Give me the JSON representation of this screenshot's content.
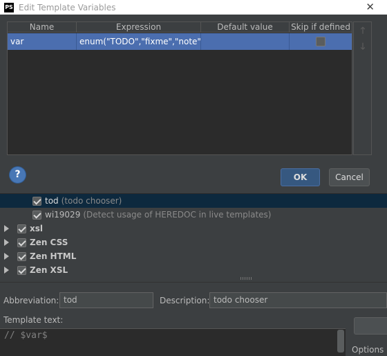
{
  "dialog": {
    "title": "Edit Template Variables",
    "app_icon": "PS",
    "close": "✕",
    "columns": [
      "Name",
      "Expression",
      "Default value",
      "Skip if defined"
    ],
    "rows": [
      {
        "name": "var",
        "expression": "enum(\"TODO\",\"fixme\",\"note\")",
        "default_value": "",
        "skip_if_defined": false
      }
    ],
    "move_up": "🡑",
    "move_down": "🡓",
    "help_label": "?",
    "ok_label": "OK",
    "cancel_label": "Cancel"
  },
  "tree": {
    "items": [
      {
        "label": "tod",
        "desc": "(todo chooser)",
        "checked": true,
        "selected": true
      },
      {
        "label": "wi19029",
        "desc": "(Detect usage of HEREDOC in live templates)",
        "checked": true,
        "selected": false
      }
    ],
    "groups": [
      {
        "label": "xsl",
        "checked": true
      },
      {
        "label": "Zen CSS",
        "checked": true
      },
      {
        "label": "Zen HTML",
        "checked": true
      },
      {
        "label": "Zen XSL",
        "checked": true
      }
    ]
  },
  "editor_panel": {
    "abbreviation_label": "Abbreviation:",
    "abbreviation_value": "tod",
    "description_label": "Description:",
    "description_value": "todo chooser",
    "template_text_label": "Template text:",
    "template_text": "// $var$",
    "options_label": "Options"
  },
  "colors": {
    "background": "#3c3f41",
    "selection": "#4b6eaf",
    "tree_selection": "#0d293e",
    "ok_button": "#365880"
  }
}
